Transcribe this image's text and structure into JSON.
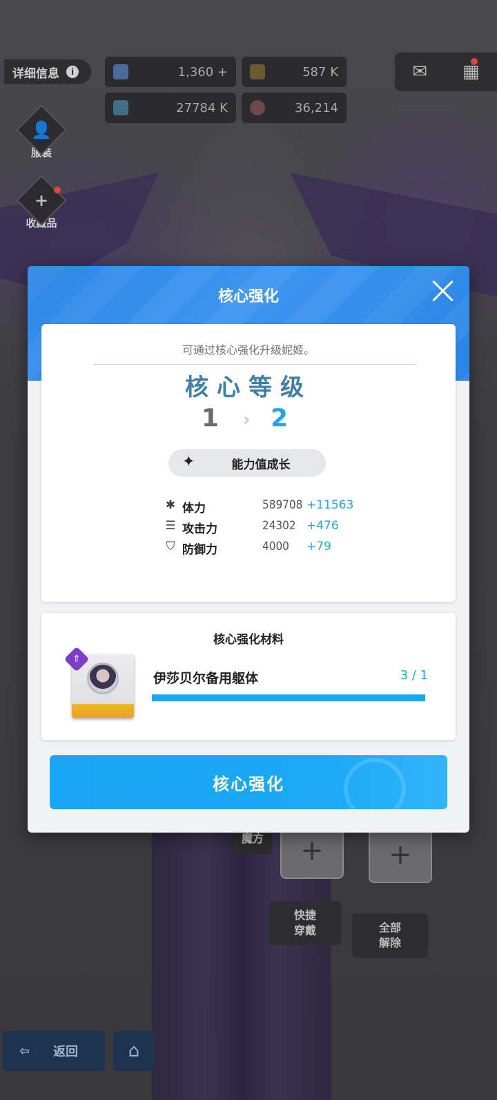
{
  "top_bar": {
    "detail_label": "详细信息",
    "info_glyph": "i",
    "resources": [
      {
        "icon": "crystal-icon",
        "value": "1,360",
        "add": "+"
      },
      {
        "icon": "credit-icon",
        "value": "587 K"
      },
      {
        "icon": "battle-data-icon",
        "value": "27784 K"
      },
      {
        "icon": "core-dust-icon",
        "value": "36,214"
      }
    ]
  },
  "side_menu": {
    "costume_label": "服装",
    "collection_label": "收藏品"
  },
  "modal": {
    "title": "核心强化",
    "description": "可通过核心强化升级妮姬。",
    "level_title": "核心等级",
    "level_from": "1",
    "level_to": "2",
    "growth_label": "能力值成长",
    "stats": [
      {
        "icon": "hp-icon",
        "name": "体力",
        "value": "589708",
        "increase": "+11563"
      },
      {
        "icon": "attack-icon",
        "name": "攻击力",
        "value": "24302",
        "increase": "+476"
      },
      {
        "icon": "defense-icon",
        "name": "防御力",
        "value": "4000",
        "increase": "+79"
      }
    ],
    "materials_title": "核心强化材料",
    "material": {
      "name": "伊莎贝尔备用躯体",
      "count": "3 / 1",
      "progress": 1.0
    },
    "confirm_label": "核心强化"
  },
  "background_ui": {
    "cube_label": "魔方",
    "quick_equip_label": "快捷\n穿戴",
    "unequip_all_label": "全部\n解除",
    "back_label": "返回"
  },
  "colors": {
    "accent": "#1ea7f0",
    "header": "#2e86e6",
    "level_title": "#3e7fa8"
  }
}
